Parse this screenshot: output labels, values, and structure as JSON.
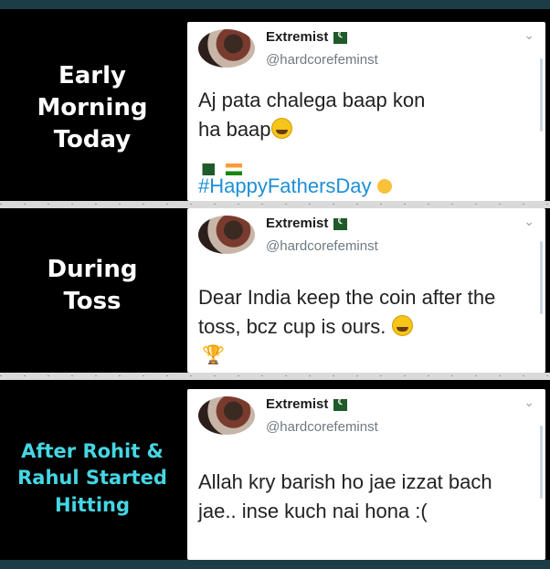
{
  "panels": [
    {
      "caption_lines": [
        "Early",
        "Morning",
        "Today"
      ],
      "tweet": {
        "name": "Extremist",
        "handle": "@hardcorefeminst",
        "text_lines": [
          "Aj pata chalega baap kon",
          "ha baap"
        ],
        "hashtag": "#HappyFathersDay"
      }
    },
    {
      "caption_lines": [
        "During",
        "Toss"
      ],
      "tweet": {
        "name": "Extremist",
        "handle": "@hardcorefeminst",
        "text_lines": [
          "Dear India keep the coin after the",
          "toss, bcz cup is ours."
        ]
      }
    },
    {
      "caption_lines": [
        "After Rohit &",
        "Rahul Started",
        "Hitting"
      ],
      "tweet": {
        "name": "Extremist",
        "handle": "@hardcorefeminst",
        "text_lines": [
          "Allah kry barish ho jae izzat bach",
          "jae.. inse kuch nai hona :("
        ]
      }
    }
  ],
  "icons": {
    "more": "chevron-down-icon",
    "flags": [
      "pakistan-flag-icon",
      "india-flag-icon"
    ],
    "trophy": "trophy-icon",
    "emoji": "grinning-face-icon"
  },
  "colors": {
    "caption_white": "#ffffff",
    "caption_cyan": "#45d6e3",
    "hashtag": "#1d8fd6",
    "frame_bar": "#1c3d45"
  }
}
